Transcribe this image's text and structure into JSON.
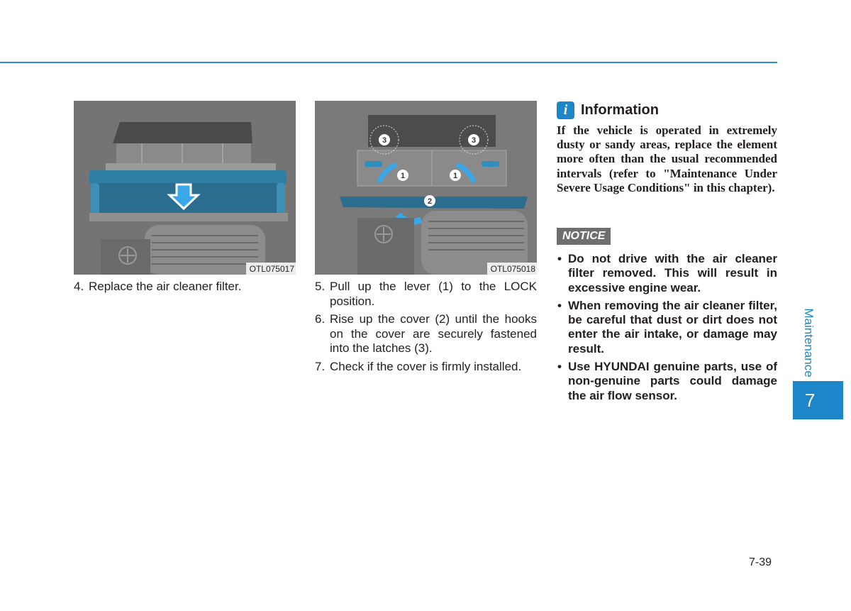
{
  "header": {
    "rule_color": "#2a8bc9"
  },
  "figures": [
    {
      "code": "OTL075017",
      "caption_step": {
        "number": "4.",
        "text": "Replace the air cleaner filter."
      }
    },
    {
      "code": "OTL075018",
      "callouts": [
        "1",
        "1",
        "2",
        "3",
        "3"
      ]
    }
  ],
  "steps": [
    {
      "number": "5.",
      "text": "Pull up the lever (1) to the LOCK position."
    },
    {
      "number": "6.",
      "text": "Rise up the cover (2) until the hooks on the cover are securely fastened into the latches (3)."
    },
    {
      "number": "7.",
      "text": "Check if the cover is firmly installed."
    }
  ],
  "information": {
    "icon": "info-icon",
    "icon_glyph": "i",
    "title": "Information",
    "body": "If the vehicle is operated in extremely dusty or sandy areas, replace the element more often than the usual recommended intervals (refer to \"Maintenance Under Severe Usage Conditions\" in this chapter)."
  },
  "notice": {
    "label": "NOTICE",
    "items": [
      "Do not drive with the air cleaner filter removed. This will result in excessive engine wear.",
      "When removing the air cleaner filter, be careful that dust or dirt does not enter the air intake, or damage may result.",
      "Use HYUNDAI genuine parts, use of non-genuine parts could damage the air flow sensor."
    ],
    "bullet": "•"
  },
  "sidebar": {
    "section_label": "Maintenance",
    "chapter_number": "7",
    "accent_color": "#1c86c8"
  },
  "footer": {
    "page_number": "7-39"
  }
}
